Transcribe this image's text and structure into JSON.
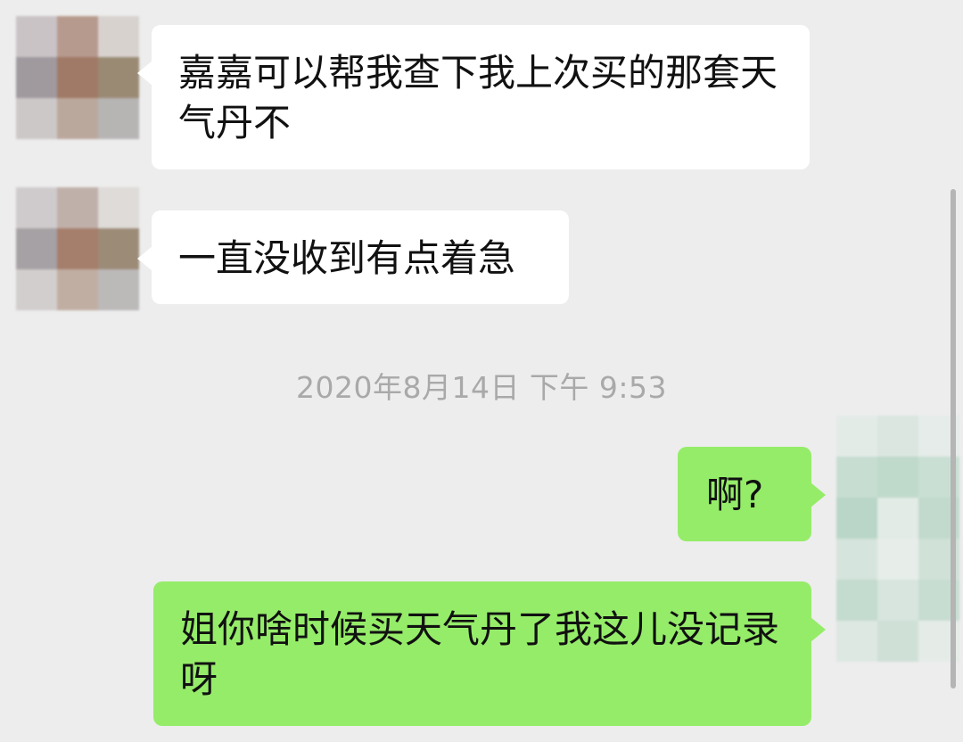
{
  "messages": [
    {
      "sender": "contact",
      "text": "嘉嘉可以帮我查下我上次买的那套天气丹不"
    },
    {
      "sender": "contact",
      "text": "一直没收到有点着急"
    },
    {
      "sender": "me",
      "text": "啊?"
    },
    {
      "sender": "me",
      "text": "姐你啥时候买天气丹了我这儿没记录呀"
    }
  ],
  "timestamp": "2020年8月14日 下午 9:53",
  "colors": {
    "background": "#ededed",
    "incoming_bubble": "#ffffff",
    "outgoing_bubble": "#95ec69",
    "timestamp_text": "#a9a9a9"
  }
}
